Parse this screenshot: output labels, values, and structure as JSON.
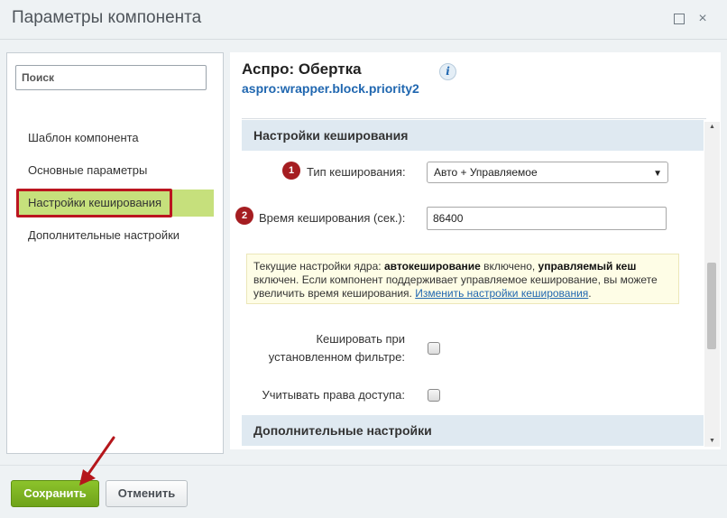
{
  "window": {
    "title": "Параметры компонента",
    "minimize_glyph": "",
    "close_glyph": "×"
  },
  "sidebar": {
    "search_placeholder": "Поиск",
    "items": [
      {
        "label": "Шаблон компонента",
        "active": false
      },
      {
        "label": "Основные параметры",
        "active": false
      },
      {
        "label": "Настройки кеширования",
        "active": true
      },
      {
        "label": "Дополнительные настройки",
        "active": false
      }
    ]
  },
  "component": {
    "title": "Аспро: Обертка",
    "code": "aspro:wrapper.block.priority2",
    "info_glyph": "i"
  },
  "caching_section": {
    "header": "Настройки кеширования",
    "cache_type": {
      "badge": "1",
      "label": "Тип кеширования:",
      "value": "Авто + Управляемое"
    },
    "cache_time": {
      "badge": "2",
      "label": "Время кеширования (сек.):",
      "value": "86400"
    },
    "notice": {
      "prefix": "Текущие настройки ядра: ",
      "bold1": "автокеширование",
      "mid": " включено, ",
      "bold2": "управляемый кеш",
      "suffix": " включен. Если компонент поддерживает управляемое кеширование, вы можете увеличить время кеширования. ",
      "link": "Изменить настройки кеширования",
      "end": "."
    },
    "cache_filter": {
      "label_line1": "Кешировать при",
      "label_line2": "установленном фильтре:",
      "checked": false
    },
    "check_access": {
      "label": "Учитывать права доступа:",
      "checked": false
    }
  },
  "extra_section": {
    "header": "Дополнительные настройки"
  },
  "footer": {
    "save_label": "Сохранить",
    "cancel_label": "Отменить"
  },
  "colors": {
    "accent_green": "#7bb327",
    "highlight_red": "#bb1520",
    "link_blue": "#2067b0",
    "section_bg": "#dfe9f1",
    "notice_bg": "#fefde6"
  }
}
